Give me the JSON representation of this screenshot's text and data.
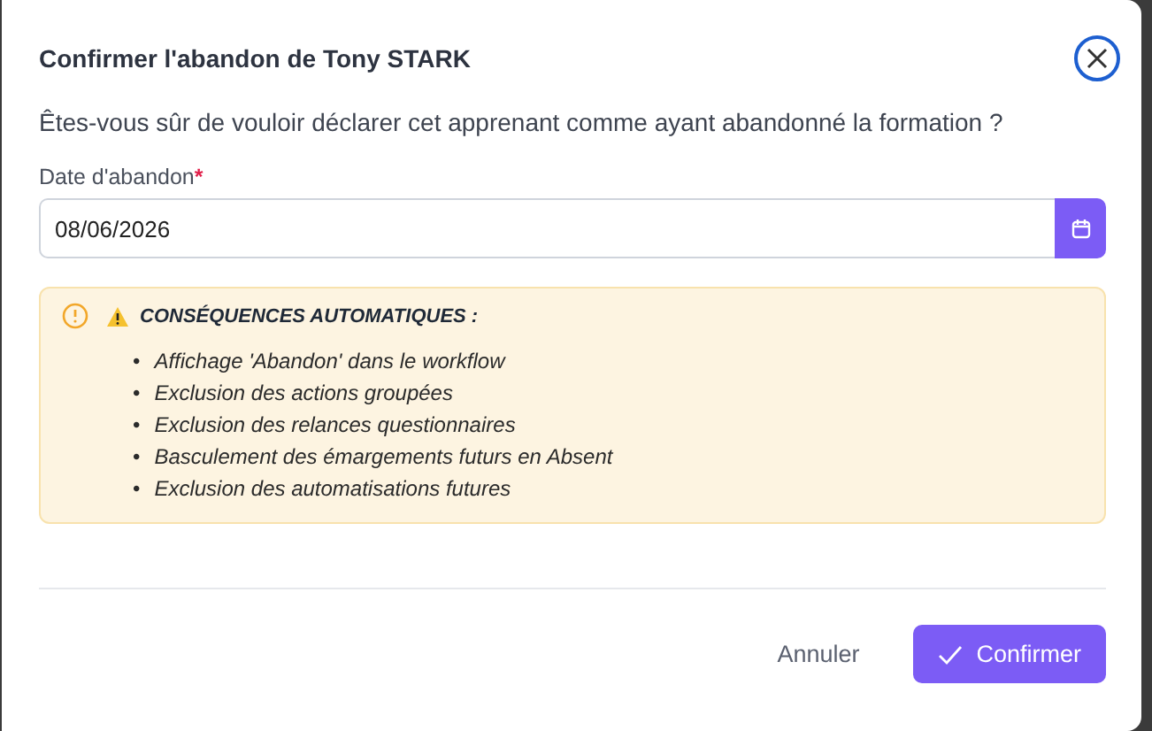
{
  "dialog": {
    "title": "Confirmer l'abandon de Tony STARK",
    "question": "Êtes-vous sûr de vouloir déclarer cet apprenant comme ayant abandonné la formation ?",
    "date_field": {
      "label": "Date d'abandon",
      "required_mark": "*",
      "value": "08/06/2026"
    },
    "alert": {
      "heading": "CONSÉQUENCES AUTOMATIQUES :",
      "items": [
        {
          "bullet": "•",
          "text": "Affichage 'Abandon' dans le workflow"
        },
        {
          "bullet": "•",
          "text": "Exclusion des actions groupées"
        },
        {
          "bullet": "•",
          "text": "Exclusion des relances questionnaires"
        },
        {
          "bullet": "•",
          "text": "Basculement des émargements futurs en Absent"
        },
        {
          "bullet": "•",
          "text": "Exclusion des automatisations futures"
        }
      ]
    },
    "buttons": [
      {
        "kind": "cancel",
        "label": "Annuler"
      },
      {
        "kind": "confirm",
        "label": "Confirmer"
      }
    ]
  }
}
